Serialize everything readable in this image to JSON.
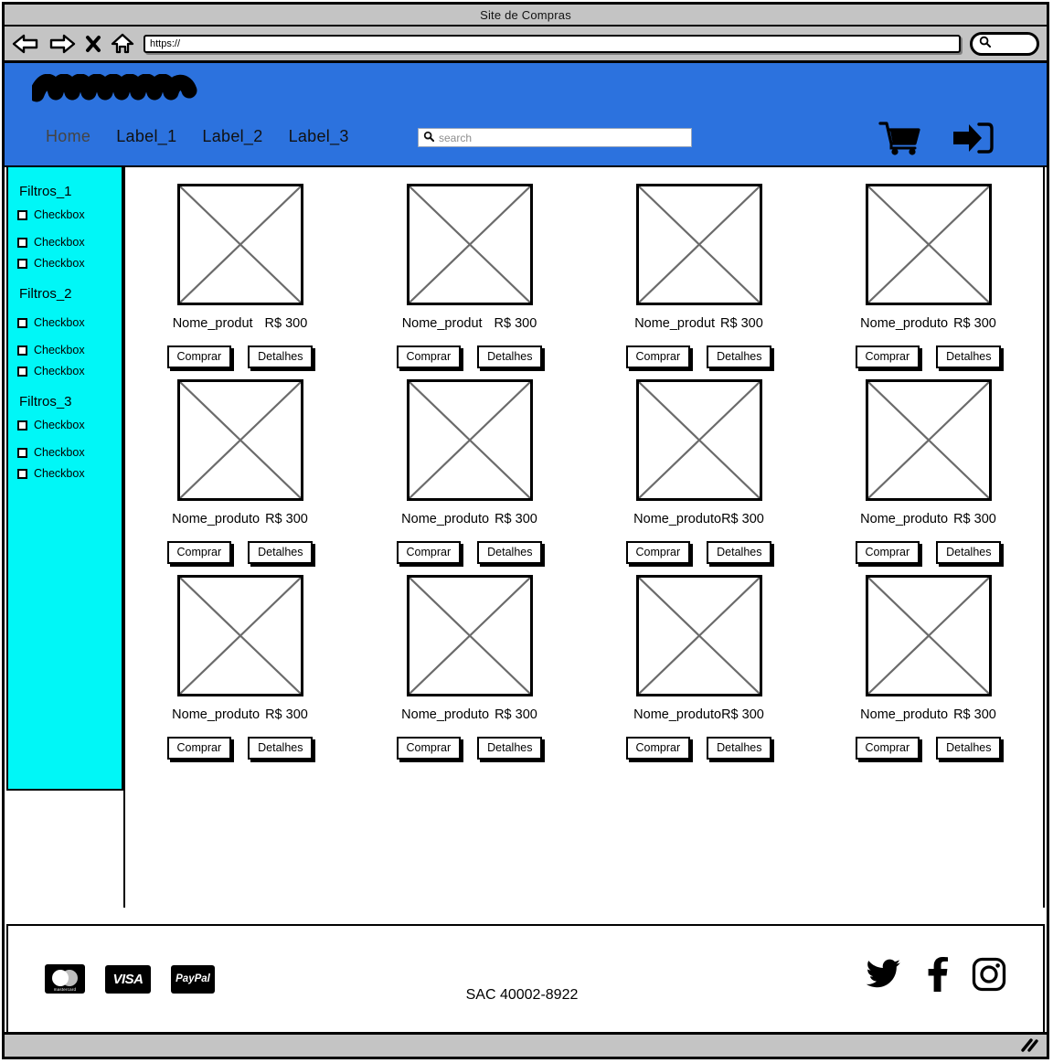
{
  "window": {
    "title": "Site de Compras",
    "url_value": "https://",
    "back_icon": "back-arrow-icon",
    "forward_icon": "forward-arrow-icon",
    "stop_icon": "close-x-icon",
    "home_icon": "home-icon",
    "browser_search_icon": "search-icon",
    "resize_grip_icon": "resize-grip-icon"
  },
  "header": {
    "logo_alt": "scribble-logo",
    "accent_color": "#2c72de",
    "nav": [
      {
        "label": "Home",
        "active": true
      },
      {
        "label": "Label_1",
        "active": false
      },
      {
        "label": "Label_2",
        "active": false
      },
      {
        "label": "Label_3",
        "active": false
      }
    ],
    "search": {
      "placeholder": "search",
      "value": "",
      "icon": "search-icon"
    },
    "cart_icon": "shopping-cart-icon",
    "login_icon": "login-arrow-icon"
  },
  "sidebar": {
    "background_color": "#00f7f7",
    "groups": [
      {
        "title": "Filtros_1",
        "options": [
          {
            "label": "Checkbox",
            "checked": false
          },
          {
            "label": "Checkbox",
            "checked": false
          },
          {
            "label": "Checkbox",
            "checked": false
          }
        ]
      },
      {
        "title": "Filtros_2",
        "options": [
          {
            "label": "Checkbox",
            "checked": false
          },
          {
            "label": "Checkbox",
            "checked": false
          },
          {
            "label": "Checkbox",
            "checked": false
          }
        ]
      },
      {
        "title": "Filtros_3",
        "options": [
          {
            "label": "Checkbox",
            "checked": false
          },
          {
            "label": "Checkbox",
            "checked": false
          },
          {
            "label": "Checkbox",
            "checked": false
          }
        ]
      }
    ]
  },
  "products": {
    "buy_label": "Comprar",
    "details_label": "Detalhes",
    "image_placeholder": "image-placeholder-cross",
    "items": [
      {
        "name": "Nome_produt",
        "price": "R$ 300",
        "spacing": "wide"
      },
      {
        "name": "Nome_produt",
        "price": "R$ 300",
        "spacing": "wide"
      },
      {
        "name": "Nome_produt",
        "price": "R$ 300",
        "spacing": "normal"
      },
      {
        "name": "Nome_produto",
        "price": "R$ 300",
        "spacing": "normal"
      },
      {
        "name": "Nome_produto",
        "price": "R$ 300",
        "spacing": "normal"
      },
      {
        "name": "Nome_produto",
        "price": "R$ 300",
        "spacing": "normal"
      },
      {
        "name": "Nome_produto",
        "price": "R$ 300",
        "spacing": "none"
      },
      {
        "name": "Nome_produto",
        "price": "R$ 300",
        "spacing": "normal"
      },
      {
        "name": "Nome_produto",
        "price": "R$ 300",
        "spacing": "normal"
      },
      {
        "name": "Nome_produto",
        "price": "R$ 300",
        "spacing": "normal"
      },
      {
        "name": "Nome_produto",
        "price": "R$ 300",
        "spacing": "none"
      },
      {
        "name": "Nome_produto",
        "price": "R$ 300",
        "spacing": "normal"
      }
    ]
  },
  "footer": {
    "payments": [
      {
        "name": "mastercard",
        "label": "mastercard"
      },
      {
        "name": "visa",
        "label": "VISA"
      },
      {
        "name": "paypal",
        "label": "PayPal"
      }
    ],
    "sac_text": "SAC 40002-8922",
    "social": [
      {
        "name": "twitter-icon"
      },
      {
        "name": "facebook-icon"
      },
      {
        "name": "instagram-icon"
      }
    ]
  }
}
